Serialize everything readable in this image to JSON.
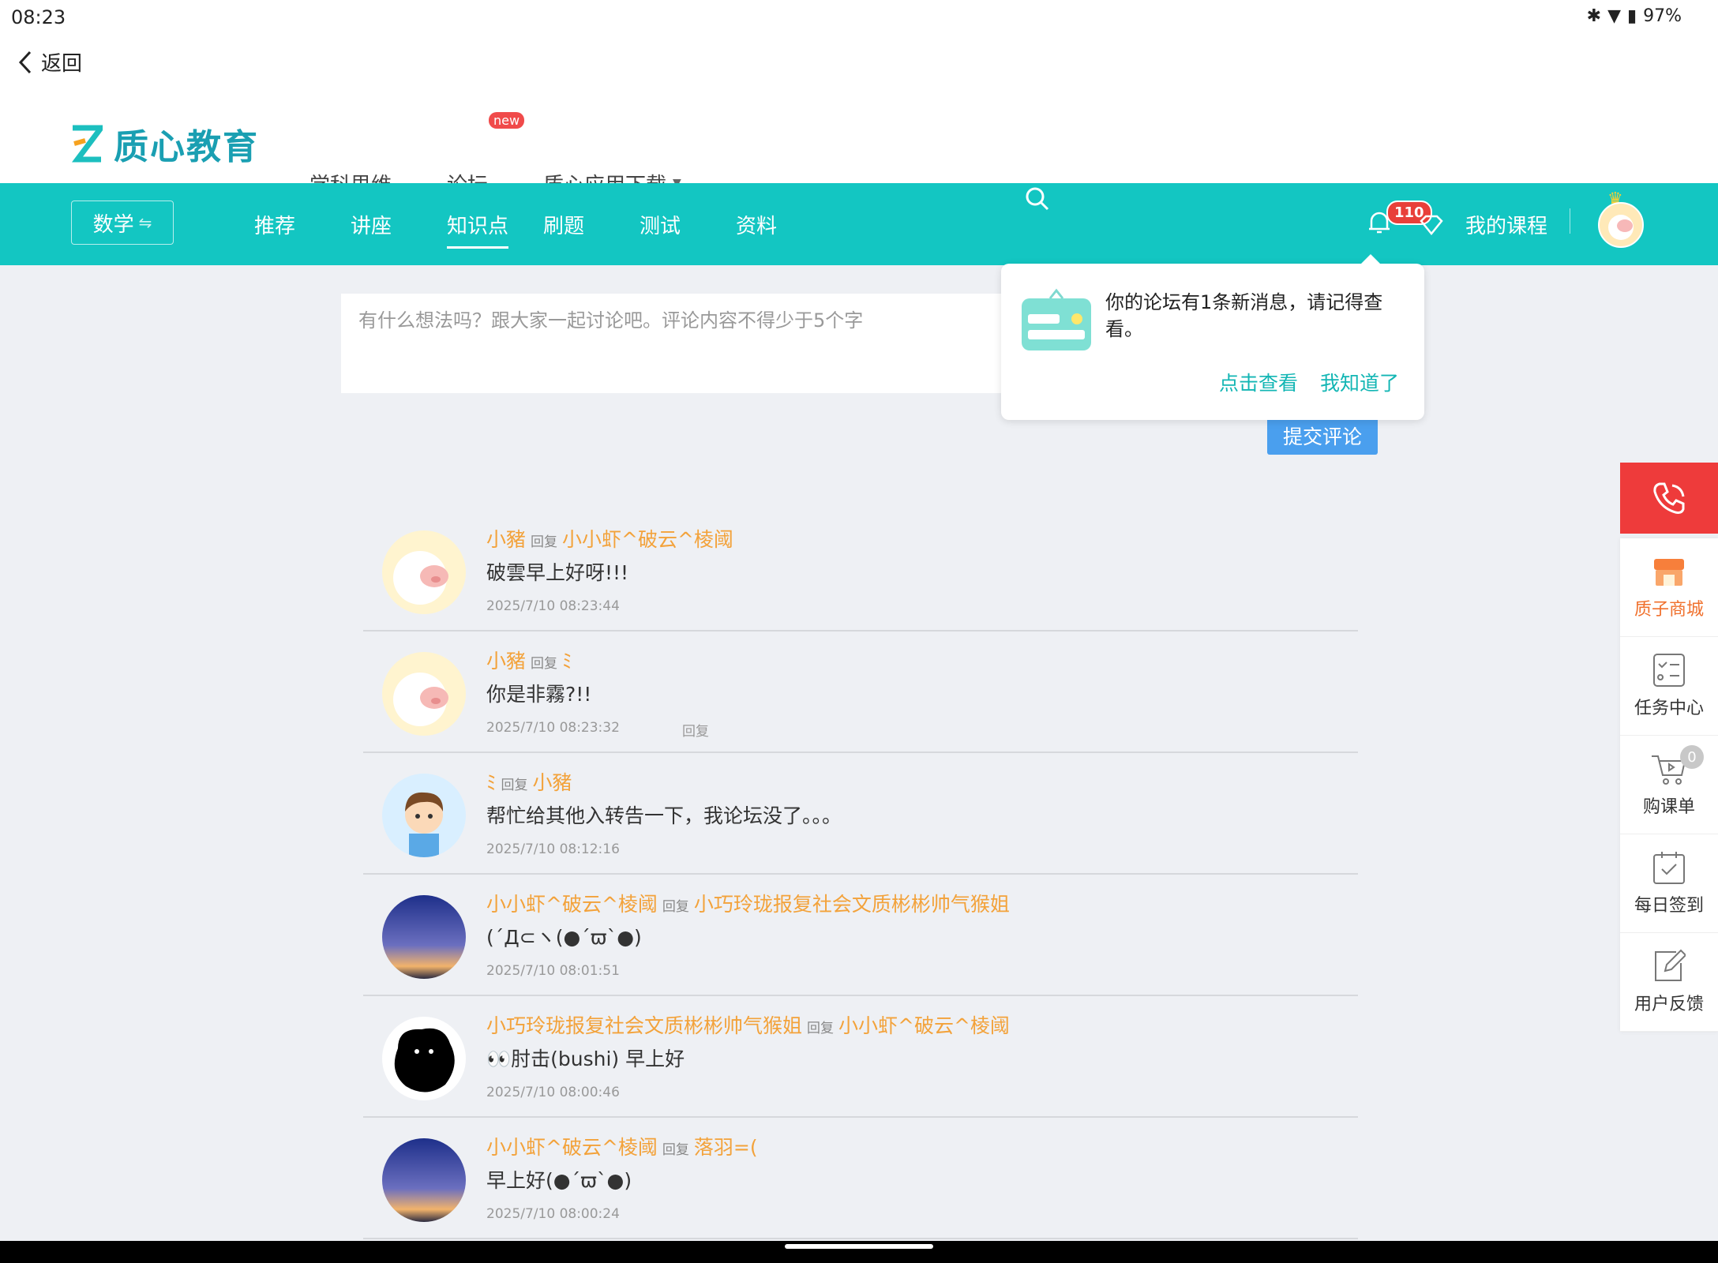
{
  "status": {
    "time": "08:23",
    "battery": "97%"
  },
  "back": {
    "label": "返回"
  },
  "brand": {
    "name": "质心教育"
  },
  "topnav": {
    "items": [
      "学科思维",
      "论坛",
      "质心应用下载"
    ],
    "new_badge": "new"
  },
  "subject": {
    "label": "数学"
  },
  "mainnav": {
    "tabs": [
      "推荐",
      "讲座",
      "知识点",
      "刷题",
      "测试",
      "资料"
    ],
    "active": "知识点"
  },
  "header_right": {
    "notif_count": "110",
    "my_course": "我的课程"
  },
  "comment": {
    "placeholder": "有什么想法吗？跟大家一起讨论吧。评论内容不得少于5个字",
    "submit": "提交评论"
  },
  "popup": {
    "message": "你的论坛有1条新消息，请记得查看。",
    "view": "点击查看",
    "dismiss": "我知道了"
  },
  "reply_word": "回复",
  "comments": [
    {
      "user": "小豬",
      "target": "小小虾^破云^棱阈",
      "content": "破雲早上好呀!!!",
      "date": "2025/7/10 08:23:44",
      "reply": ""
    },
    {
      "user": "小豬",
      "target": "ﾐ",
      "content": "你是非霧?!!",
      "date": "2025/7/10 08:23:32",
      "reply": "回复"
    },
    {
      "user": "ﾐ",
      "target": "小豬",
      "content": "帮忙给其他入转告一下，我论坛没了。。。",
      "date": "2025/7/10 08:12:16",
      "reply": ""
    },
    {
      "user": "小小虾^破云^棱阈",
      "target": "小巧玲珑报复社会文质彬彬帅气猴姐",
      "content": "(´Д⊂ヽ(●´ϖ`●)",
      "date": "2025/7/10 08:01:51",
      "reply": ""
    },
    {
      "user": "小巧玲珑报复社会文质彬彬帅气猴姐",
      "target": "小小虾^破云^棱阈",
      "content": "👀肘击(bushi) 早上好",
      "date": "2025/7/10 08:00:46",
      "reply": ""
    },
    {
      "user": "小小虾^破云^棱阈",
      "target": "落羽=(",
      "content": "早上好(●´ϖ`●)",
      "date": "2025/7/10 08:00:24",
      "reply": ""
    }
  ],
  "sidebar": {
    "items": [
      "质子商城",
      "任务中心",
      "购课单",
      "每日签到",
      "用户反馈"
    ],
    "cart_count": "0"
  },
  "colors": {
    "teal": "#13c6c2",
    "orange_name": "#f3a23a",
    "submit_blue": "#4a9fee",
    "phone_red": "#ee3b3b"
  }
}
